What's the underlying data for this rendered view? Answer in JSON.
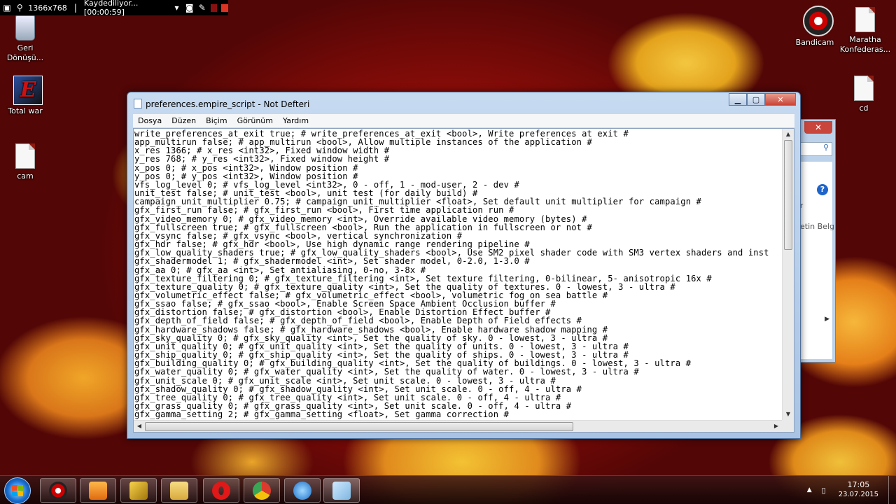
{
  "recorder": {
    "resolution": "1366x768",
    "status": "Kaydediliyor... [00:00:59]"
  },
  "desktop_icons": [
    {
      "label": "Geri Dönüşü..."
    },
    {
      "label": "Total war"
    },
    {
      "label": "cam"
    },
    {
      "label": "Bandicam"
    },
    {
      "label": "Maratha Konfederas..."
    },
    {
      "label": "cd"
    }
  ],
  "background_window": {
    "partial_text": "etin Belg",
    "partial_letter": "r"
  },
  "notepad": {
    "title": "preferences.empire_script - Not Defteri",
    "menu": [
      "Dosya",
      "Düzen",
      "Biçim",
      "Görünüm",
      "Yardım"
    ],
    "lines": [
      "write_preferences_at_exit true; # write_preferences_at_exit <bool>, Write preferences at exit #",
      "app_multirun false; # app_multirun <bool>, Allow multiple instances of the application #",
      "x_res 1366; # x_res <int32>, Fixed window width #",
      "y_res 768; # y_res <int32>, Fixed window height #",
      "x_pos 0; # x_pos <int32>, Window position #",
      "y_pos 0; # y_pos <int32>, Window position #",
      "vfs_log_level 0; # vfs_log_level <int32>, 0 - off, 1 - mod-user, 2 - dev #",
      "unit_test false; # unit_test <bool>, unit test (for daily build) #",
      "campaign_unit_multiplier 0.75; # campaign_unit_multiplier <float>, Set default unit multiplier for campaign #",
      "gfx_first_run false; # gfx_first_run <bool>, First time application run #",
      "gfx_video_memory 0; # gfx_video_memory <int>, Override available video memory (bytes) #",
      "gfx_fullscreen true; # gfx_fullscreen <bool>, Run the application in fullscreen or not #",
      "gfx_vsync false; # gfx_vsync <bool>, vertical synchronization #",
      "gfx_hdr false; # gfx_hdr <bool>, Use high dynamic range rendering pipeline #",
      "gfx_low_quality_shaders true; # gfx_low_quality_shaders <bool>, Use SM2 pixel shader code with SM3 vertex shaders and inst",
      "gfx_shadermodel 1; # gfx_shadermodel <int>, Set shader model, 0-2.0, 1-3.0 #",
      "gfx_aa 0; # gfx_aa <int>, Set antialiasing, 0-no, 3-8x #",
      "gfx_texture_filtering 0; # gfx_texture_filtering <int>, Set texture filtering, 0-bilinear, 5- anisotropic 16x #",
      "gfx_texture_quality 0; # gfx_texture_quality <int>, Set the quality of textures. 0 - lowest, 3 - ultra #",
      "gfx_volumetric_effect false; # gfx_volumetric_effect <bool>, volumetric fog on sea battle #",
      "gfx_ssao false; # gfx_ssao <bool>, Enable Screen Space Ambient Occlusion buffer #",
      "gfx_distortion false; # gfx_distortion <bool>, Enable Distortion Effect buffer #",
      "gfx_depth_of_field false; # gfx_depth_of_field <bool>, Enable Depth of Field effects #",
      "gfx_hardware_shadows false; # gfx_hardware_shadows <bool>, Enable hardware shadow mapping #",
      "gfx_sky_quality 0; # gfx_sky_quality <int>, Set the quality of sky. 0 - lowest, 3 - ultra #",
      "gfx_unit_quality 0; # gfx_unit_quality <int>, Set the quality of units. 0 - lowest, 3 - ultra #",
      "gfx_ship_quality 0; # gfx_ship_quality <int>, Set the quality of ships. 0 - lowest, 3 - ultra #",
      "gfx_building_quality 0; # gfx_building_quality <int>, Set the quality of buildings. 0 - lowest, 3 - ultra #",
      "gfx_water_quality 0; # gfx_water_quality <int>, Set the quality of water. 0 - lowest, 3 - ultra #",
      "gfx_unit_scale 0; # gfx_unit_scale <int>, Set unit scale. 0 - lowest, 3 - ultra #",
      "gfx_shadow_quality 0; # gfx_shadow_quality <int>, Set unit scale. 0 - off, 4 - ultra #",
      "gfx_tree_quality 0; # gfx_tree_quality <int>, Set unit scale. 0 - off, 4 - ultra #",
      "gfx_grass_quality 0; # gfx_grass_quality <int>, Set unit scale. 0 - off, 4 - ultra #",
      "gfx_gamma_setting 2; # gfx_gamma_setting <float>, Set gamma correction #"
    ]
  },
  "taskbar": {
    "apps": [
      "bandicam",
      "media-player",
      "winamp",
      "file-explorer",
      "opera",
      "chrome",
      "internet-explorer",
      "notepad"
    ],
    "clock_time": "17:05",
    "clock_date": "23.07.2015"
  }
}
